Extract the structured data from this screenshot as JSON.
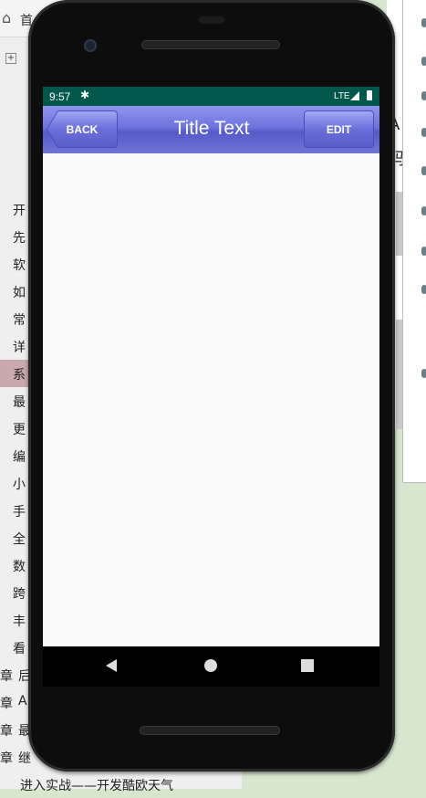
{
  "background": {
    "left_tab_label": "首",
    "tree_rows": [
      "开",
      "先",
      "软",
      "如",
      "常",
      "详",
      "系",
      "最",
      "更",
      "编",
      "小",
      "手",
      "全",
      "数",
      "跨",
      "丰",
      "看"
    ],
    "chapter_rows": [
      {
        "prefix": "章",
        "text": "后"
      },
      {
        "prefix": "章",
        "text": "A"
      },
      {
        "prefix": "章",
        "text": "最"
      },
      {
        "prefix": "章",
        "text": "继"
      }
    ],
    "last_row_text": "进入实战——开发酷欧天气",
    "right_panel_glyphs": [
      "A",
      "码"
    ]
  },
  "statusbar": {
    "time": "9:57",
    "network": "LTE"
  },
  "titlebar": {
    "back_label": "BACK",
    "title": "Title Text",
    "edit_label": "EDIT"
  },
  "colors": {
    "statusbar": "#00574b",
    "titlebar": "#6d73de",
    "screen_bg": "#fafafa"
  }
}
